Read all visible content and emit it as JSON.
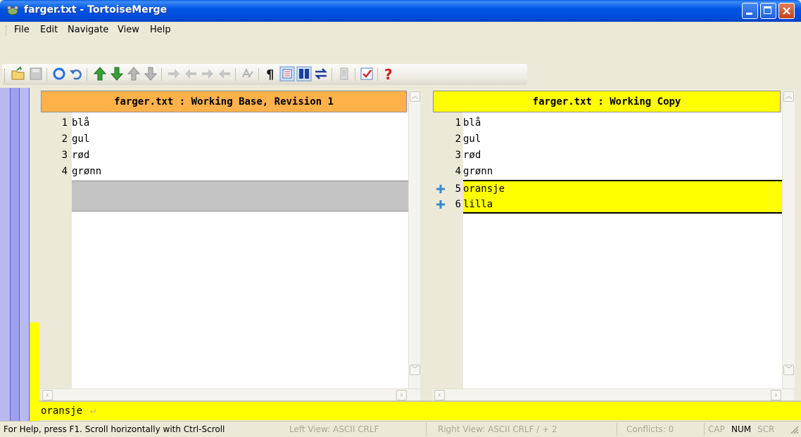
{
  "window": {
    "title": "farger.txt - TortoiseMerge"
  },
  "menu": {
    "items": [
      "File",
      "Edit",
      "Navigate",
      "View",
      "Help"
    ]
  },
  "toolbar": {
    "icons": [
      "open-icon",
      "save-icon",
      "reload-icon",
      "undo-icon",
      "next-difference-icon",
      "previous-difference-icon",
      "next-conflict-icon",
      "previous-conflict-icon",
      "use-block-icon",
      "use-block-before-icon",
      "use-block-after-icon",
      "use-other-block-icon",
      "inline-diff-icon",
      "whitespace-icon",
      "one-pane-view-icon",
      "two-pane-view-icon",
      "three-pane-toggle-icon",
      "patch-icon",
      "mark-resolved-icon",
      "help-icon"
    ]
  },
  "left_pane": {
    "header": "farger.txt : Working Base, Revision 1",
    "header_color": "#ffb14a",
    "lines": [
      {
        "num": "1",
        "text": "blå"
      },
      {
        "num": "2",
        "text": "gul"
      },
      {
        "num": "3",
        "text": "rød"
      },
      {
        "num": "4",
        "text": "grønn"
      }
    ]
  },
  "right_pane": {
    "header": "farger.txt : Working Copy",
    "header_color": "#ffff00",
    "lines": [
      {
        "num": "1",
        "text": "blå"
      },
      {
        "num": "2",
        "text": "gul"
      },
      {
        "num": "3",
        "text": "rød"
      },
      {
        "num": "4",
        "text": "grønn"
      },
      {
        "num": "5",
        "text": "oransje"
      },
      {
        "num": "6",
        "text": "lilla"
      }
    ],
    "added_color": "#ffff00"
  },
  "bottom_line": {
    "text": "oransje"
  },
  "status": {
    "help": "For Help, press F1. Scroll horizontally with Ctrl-Scroll",
    "left_view": "Left View: ASCII CRLF",
    "right_view": "Right View: ASCII CRLF  / + 2",
    "conflicts": "Conflicts: 0",
    "cap": "CAP",
    "num": "NUM",
    "scrl": "SCRL"
  }
}
